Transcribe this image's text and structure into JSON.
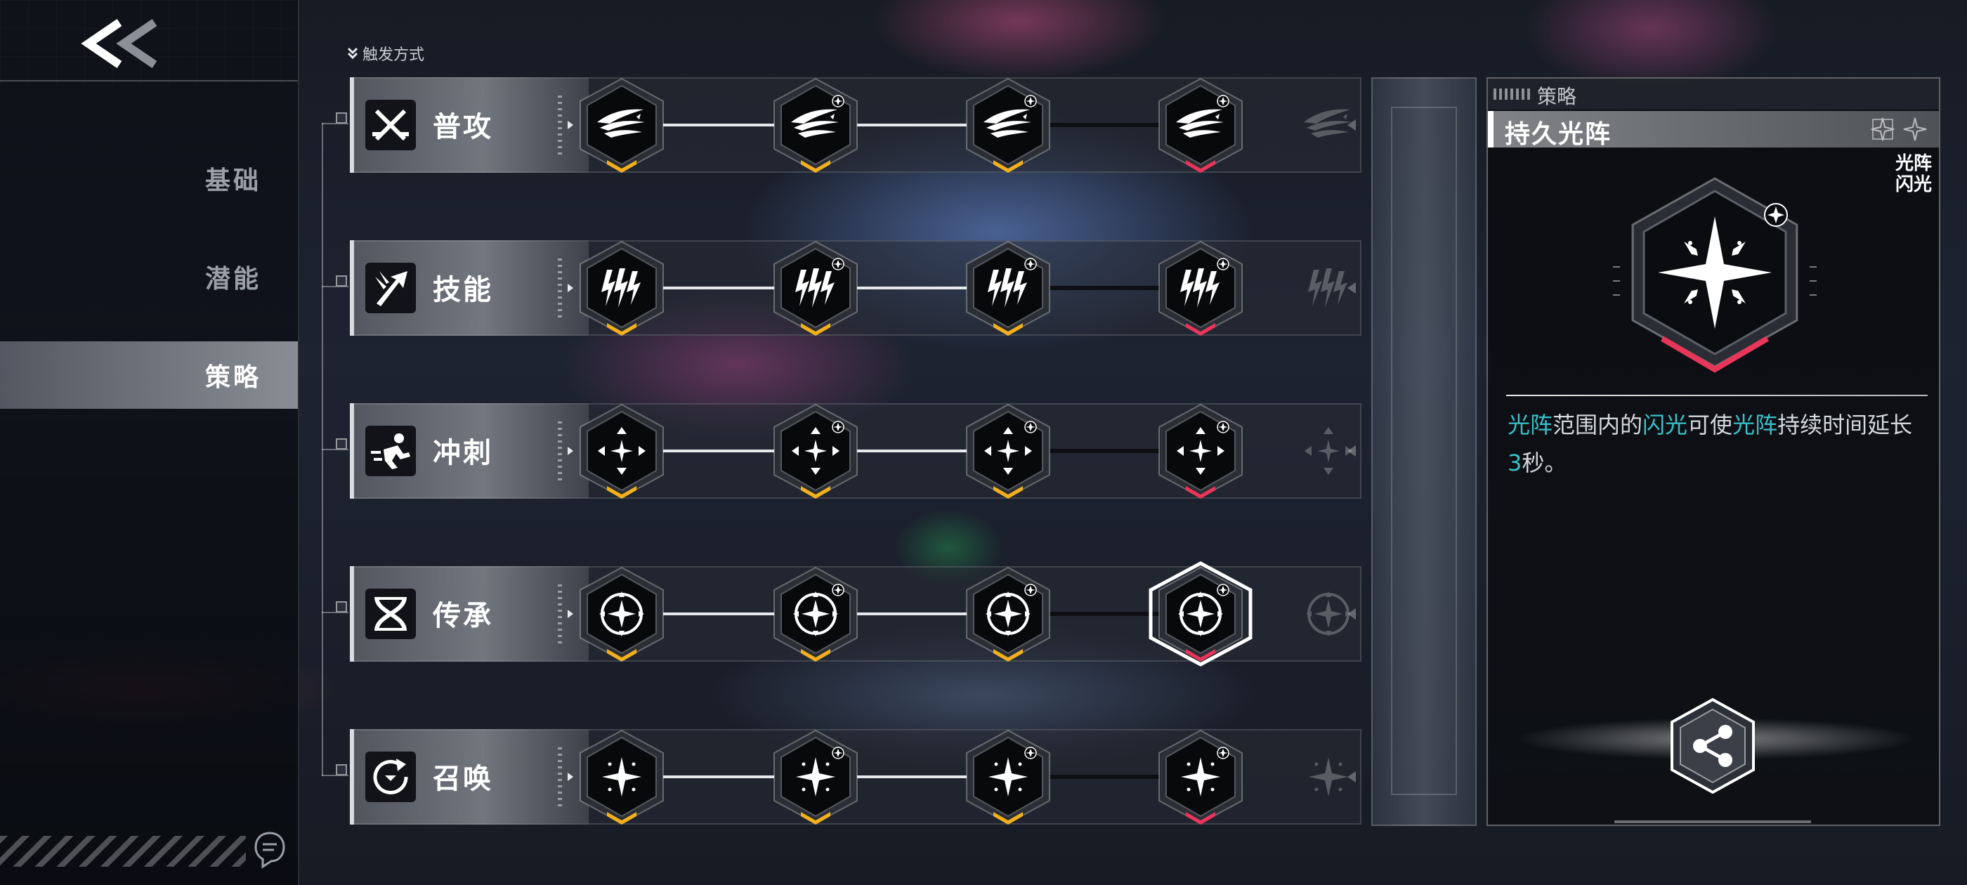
{
  "nav": {
    "back_icon": "double-chevron-left-icon",
    "items": [
      {
        "label": "基础",
        "active": false
      },
      {
        "label": "潜能",
        "active": false
      },
      {
        "label": "策略",
        "active": true
      }
    ]
  },
  "trigger_label": "触发方式",
  "rows": [
    {
      "name": "普攻",
      "icon": "crossed-swords-icon",
      "emblem": "feather-streaks",
      "last_selected": false
    },
    {
      "name": "技能",
      "icon": "arrow-burst-icon",
      "emblem": "lightning-claws",
      "last_selected": false
    },
    {
      "name": "冲刺",
      "icon": "dash-runner-icon",
      "emblem": "crosshair-star",
      "last_selected": false
    },
    {
      "name": "传承",
      "icon": "dna-helix-icon",
      "emblem": "spark-ring",
      "last_selected": true
    },
    {
      "name": "召唤",
      "icon": "summon-circle-icon",
      "emblem": "four-point-star",
      "last_selected": false
    }
  ],
  "panel": {
    "header_label": "策略",
    "title": "持久光阵",
    "tags": [
      "光阵",
      "闪光"
    ],
    "description": [
      {
        "text": "光阵",
        "hl": true
      },
      {
        "text": "范围内的",
        "hl": false
      },
      {
        "text": "闪光",
        "hl": true
      },
      {
        "text": "可使",
        "hl": false
      },
      {
        "text": "光阵",
        "hl": true
      },
      {
        "text": "持续时间延长",
        "hl": false
      },
      {
        "text": "3",
        "hl": true
      },
      {
        "text": "秒。",
        "hl": false
      }
    ],
    "share_icon": "share-icon"
  },
  "colors": {
    "accent_cyan": "#37c2c8",
    "tier_gold": "#f2b01e",
    "tier_red": "#e8365a"
  }
}
